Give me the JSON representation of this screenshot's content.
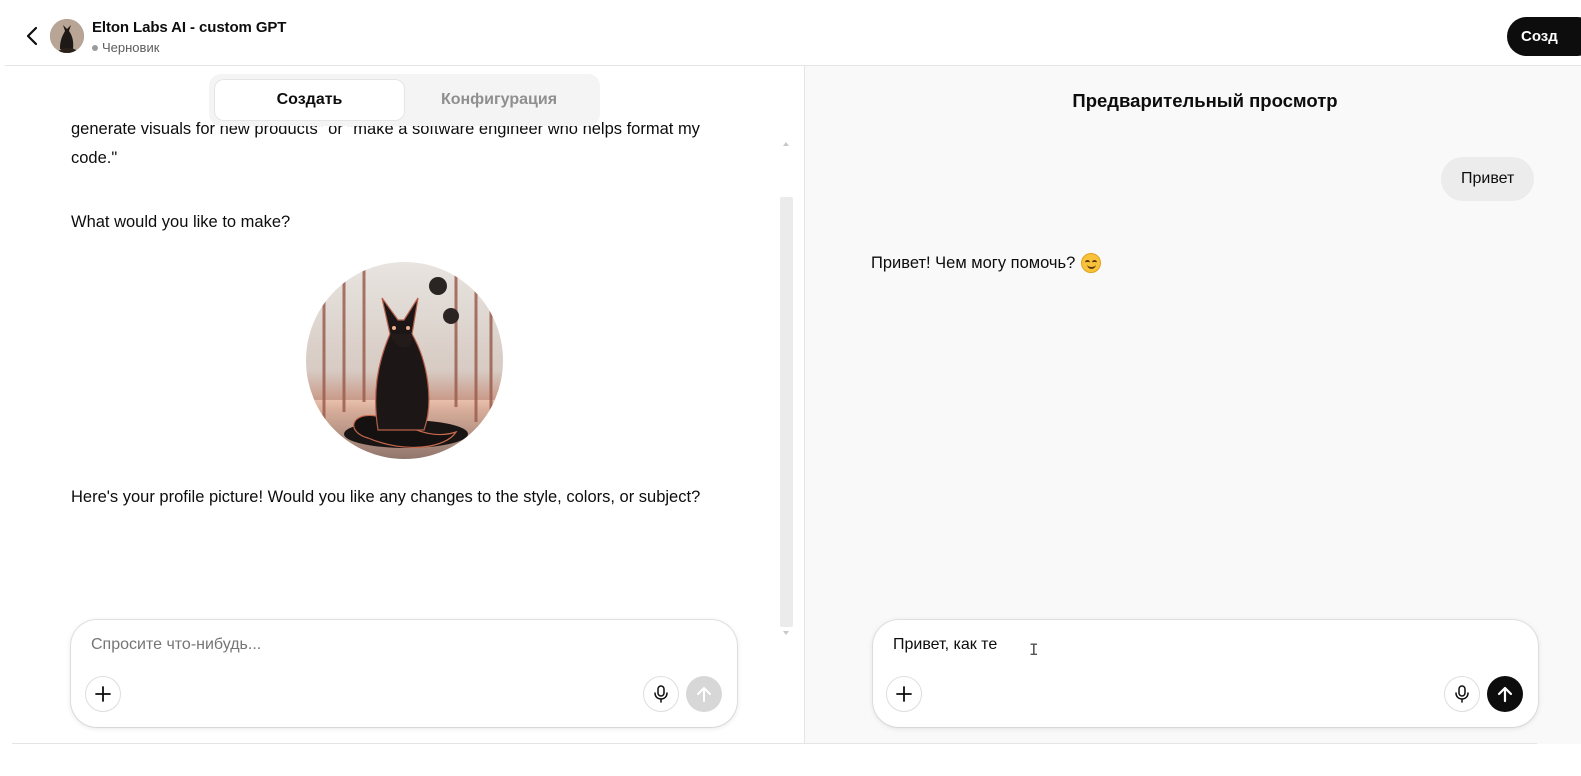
{
  "header": {
    "back_icon": "chevron-left-icon",
    "title": "Elton Labs AI - custom GPT",
    "status": "Черновик",
    "create_button": "Созд"
  },
  "tabs": [
    {
      "label": "Создать",
      "active": true
    },
    {
      "label": "Конфигурация",
      "active": false
    }
  ],
  "builder_chat": {
    "messages": [
      "generate visuals for new products\" or \"make a software engineer who helps format my code.\"",
      "What would you like to make?",
      "Here's your profile picture! Would you like any changes to the style, colors, or subject?"
    ],
    "composer": {
      "placeholder": "Спросите что-нибудь...",
      "value": ""
    }
  },
  "preview": {
    "title": "Предварительный просмотр",
    "user_message": "Привет",
    "assistant_message": "Привет! Чем могу помочь?",
    "assistant_emoji": "smiling-face-icon",
    "composer": {
      "value": "Привет, как те"
    }
  },
  "colors": {
    "primary_button": "#0d0d0d",
    "preview_background": "#f9f9f9",
    "user_bubble": "#ececec",
    "disabled_send": "#d7d7d7"
  }
}
